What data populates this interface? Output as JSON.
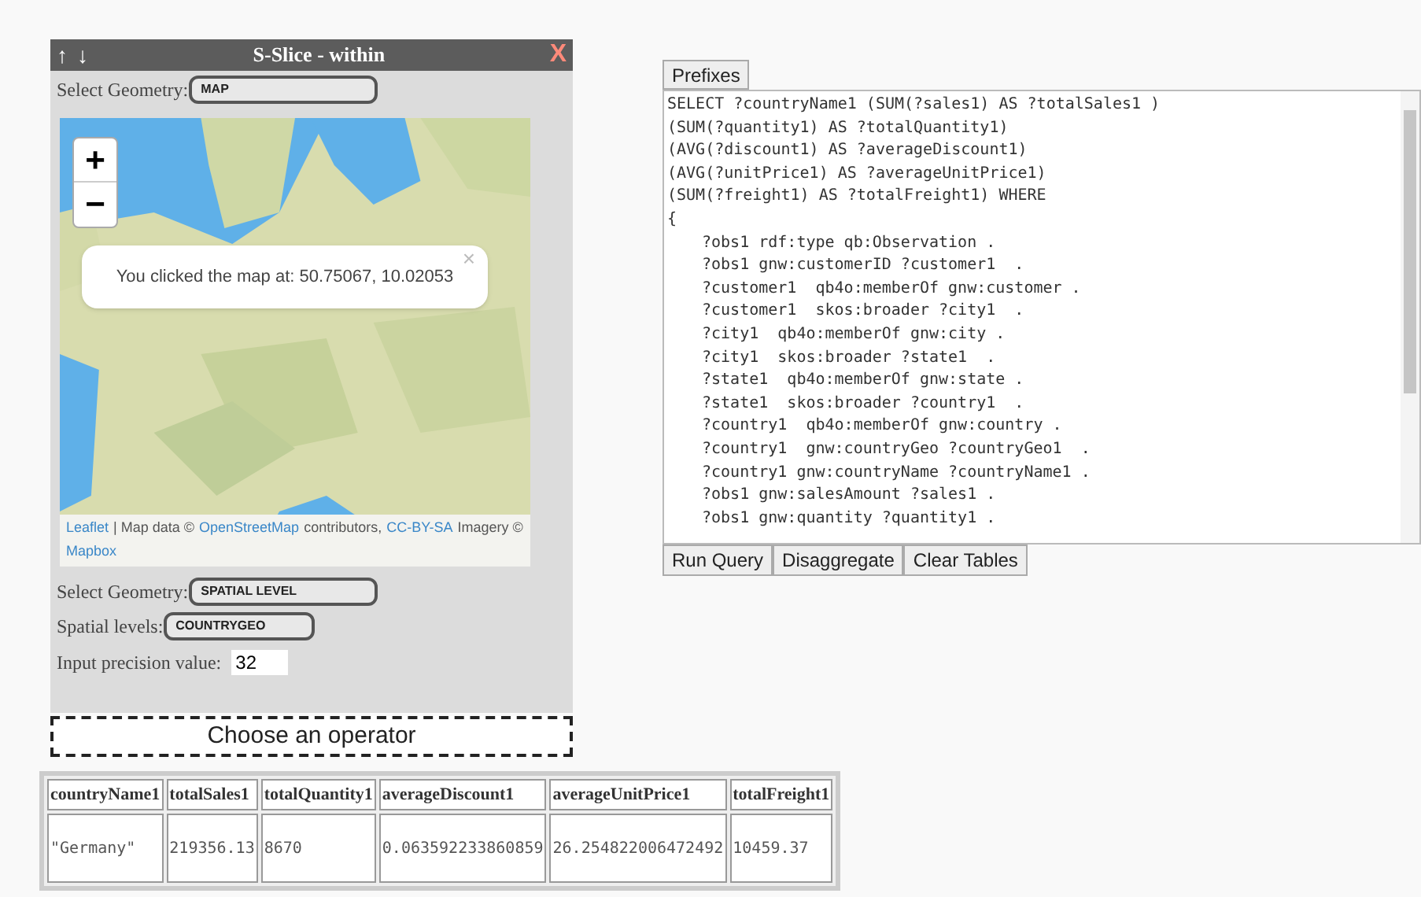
{
  "panel": {
    "title": "S-Slice - within",
    "up_arrow": "↑",
    "down_arrow": "↓",
    "close": "X",
    "geometry": {
      "label": "Select Geometry:",
      "value": "MAP"
    },
    "map": {
      "zoom_in": "+",
      "zoom_out": "−",
      "popup": {
        "text": "You clicked the map at: 50.75067, 10.02053",
        "close": "×"
      },
      "attribution": [
        {
          "kind": "link",
          "text": "Leaflet"
        },
        {
          "kind": "text",
          "text": "| Map data ©"
        },
        {
          "kind": "link",
          "text": "OpenStreetMap"
        },
        {
          "kind": "text",
          "text": "contributors,"
        },
        {
          "kind": "link",
          "text": "CC-BY-SA"
        },
        {
          "kind": "text",
          "text": "Imagery ©"
        },
        {
          "kind": "link",
          "text": "Mapbox"
        }
      ]
    },
    "geometry_2": {
      "label": "Select Geometry:",
      "value": "SPATIAL LEVEL"
    },
    "spatial_levels": {
      "label": "Spatial levels:",
      "value": "COUNTRYGEO"
    },
    "precision": {
      "label": "Input precision value:",
      "value": "32"
    }
  },
  "operator_drop": "Choose an operator",
  "query": {
    "prefixes_button": "Prefixes",
    "lines": [
      {
        "kind": "head",
        "text": "SELECT ?countryName1 (SUM(?sales1) AS ?totalSales1 )"
      },
      {
        "kind": "head",
        "text": "(SUM(?quantity1) AS ?totalQuantity1)"
      },
      {
        "kind": "head",
        "text": "(AVG(?discount1) AS ?averageDiscount1)"
      },
      {
        "kind": "head",
        "text": "(AVG(?unitPrice1) AS ?averageUnitPrice1)"
      },
      {
        "kind": "head",
        "text": "(SUM(?freight1) AS ?totalFreight1) WHERE"
      },
      {
        "kind": "head",
        "text": "{"
      },
      {
        "kind": "body",
        "text": "?obs1 rdf:type qb:Observation ."
      },
      {
        "kind": "body",
        "text": "?obs1 gnw:customerID ?customer1  ."
      },
      {
        "kind": "body",
        "text": "?customer1  qb4o:memberOf gnw:customer ."
      },
      {
        "kind": "body",
        "text": "?customer1  skos:broader ?city1  ."
      },
      {
        "kind": "body",
        "text": "?city1  qb4o:memberOf gnw:city ."
      },
      {
        "kind": "body",
        "text": "?city1  skos:broader ?state1  ."
      },
      {
        "kind": "body",
        "text": "?state1  qb4o:memberOf gnw:state ."
      },
      {
        "kind": "body",
        "text": "?state1  skos:broader ?country1  ."
      },
      {
        "kind": "body",
        "text": "?country1  qb4o:memberOf gnw:country ."
      },
      {
        "kind": "body",
        "text": "?country1  gnw:countryGeo ?countryGeo1  ."
      },
      {
        "kind": "body",
        "text": "?country1 gnw:countryName ?countryName1 ."
      },
      {
        "kind": "body",
        "text": "?obs1 gnw:salesAmount ?sales1 ."
      },
      {
        "kind": "body",
        "text": "?obs1 gnw:quantity ?quantity1 ."
      }
    ],
    "buttons": [
      "Run Query",
      "Disaggregate",
      "Clear Tables"
    ]
  },
  "table": {
    "columns": [
      "countryName1",
      "totalSales1",
      "totalQuantity1",
      "averageDiscount1",
      "averageUnitPrice1",
      "totalFreight1"
    ],
    "rows": [
      [
        "\"Germany\"",
        "219356.13",
        "8670",
        "0.063592233860859",
        "26.254822006472492",
        "10459.37"
      ]
    ]
  }
}
